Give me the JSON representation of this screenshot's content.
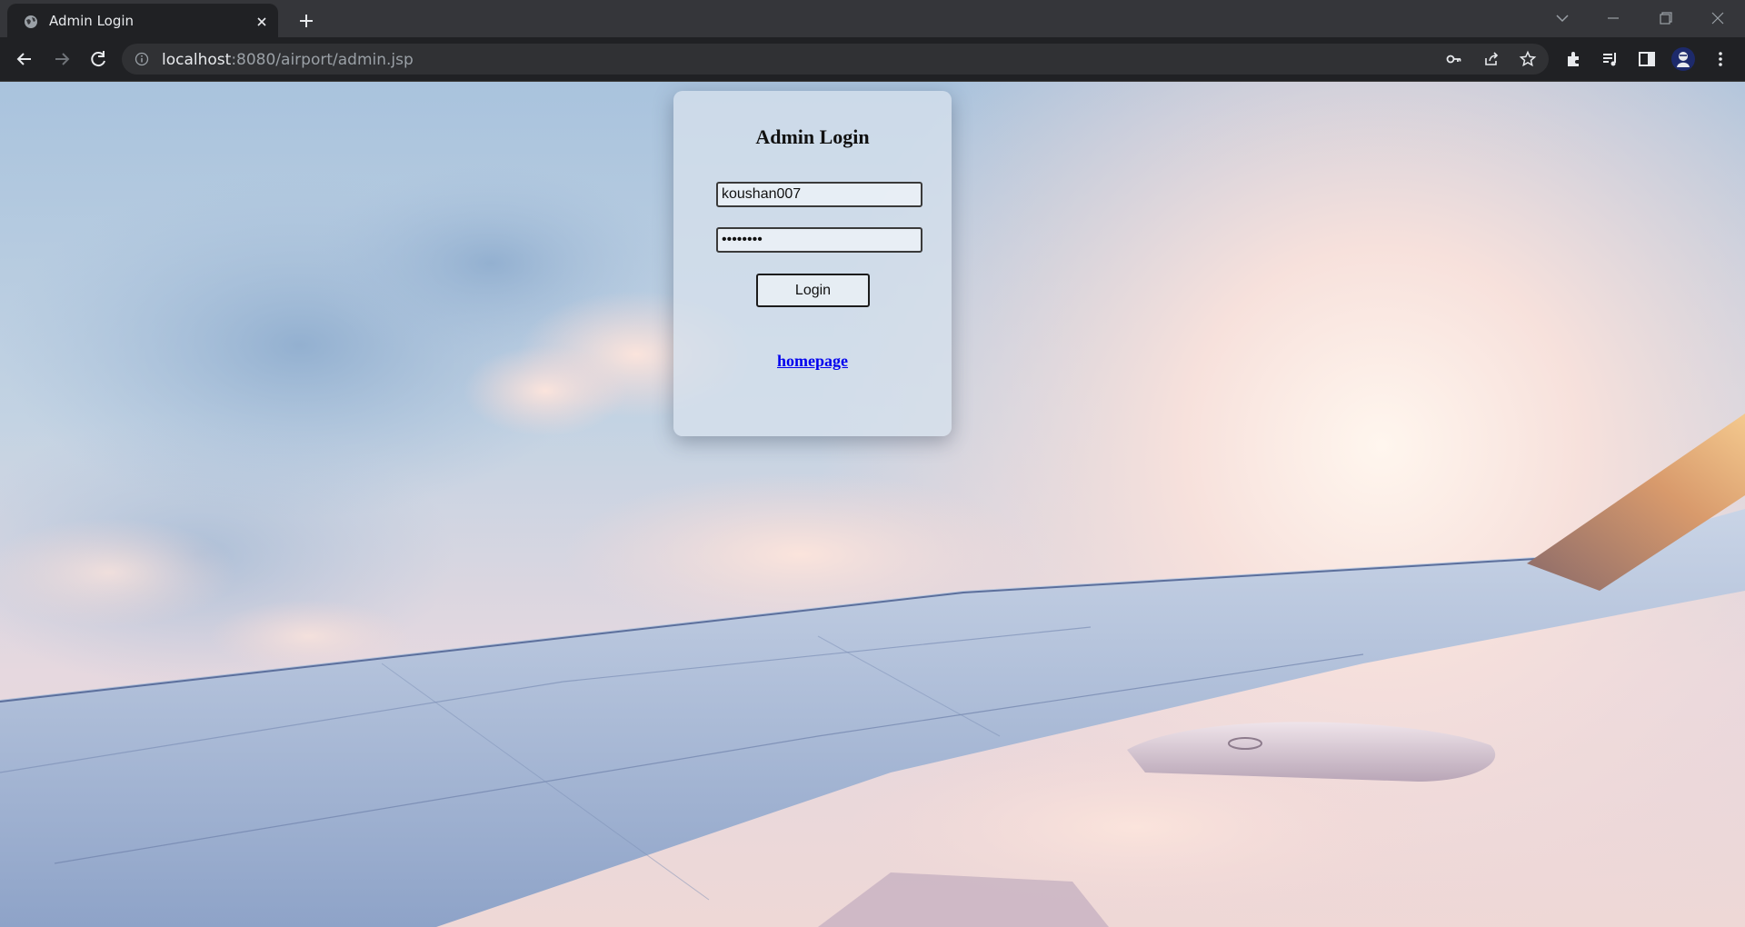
{
  "browser": {
    "tab_title": "Admin Login",
    "url_host": "localhost",
    "url_rest": ":8080/airport/admin.jsp",
    "icons": [
      "globe-icon",
      "close-icon",
      "plus-icon",
      "chevron-down-icon",
      "minimize-icon",
      "restore-icon",
      "back-icon",
      "forward-icon",
      "reload-icon",
      "info-icon",
      "key-icon",
      "share-icon",
      "star-icon",
      "extensions-icon",
      "media-icon",
      "side-panel-icon",
      "profile-avatar",
      "more-icon"
    ]
  },
  "login": {
    "heading": "Admin Login",
    "username_value": "koushan007",
    "password_value": "kkkkkkkk",
    "button_label": "Login",
    "link_text": "homepage"
  },
  "colors": {
    "link": "#0000ee",
    "chrome_dark": "#202124",
    "tabstrip": "#35363a"
  }
}
